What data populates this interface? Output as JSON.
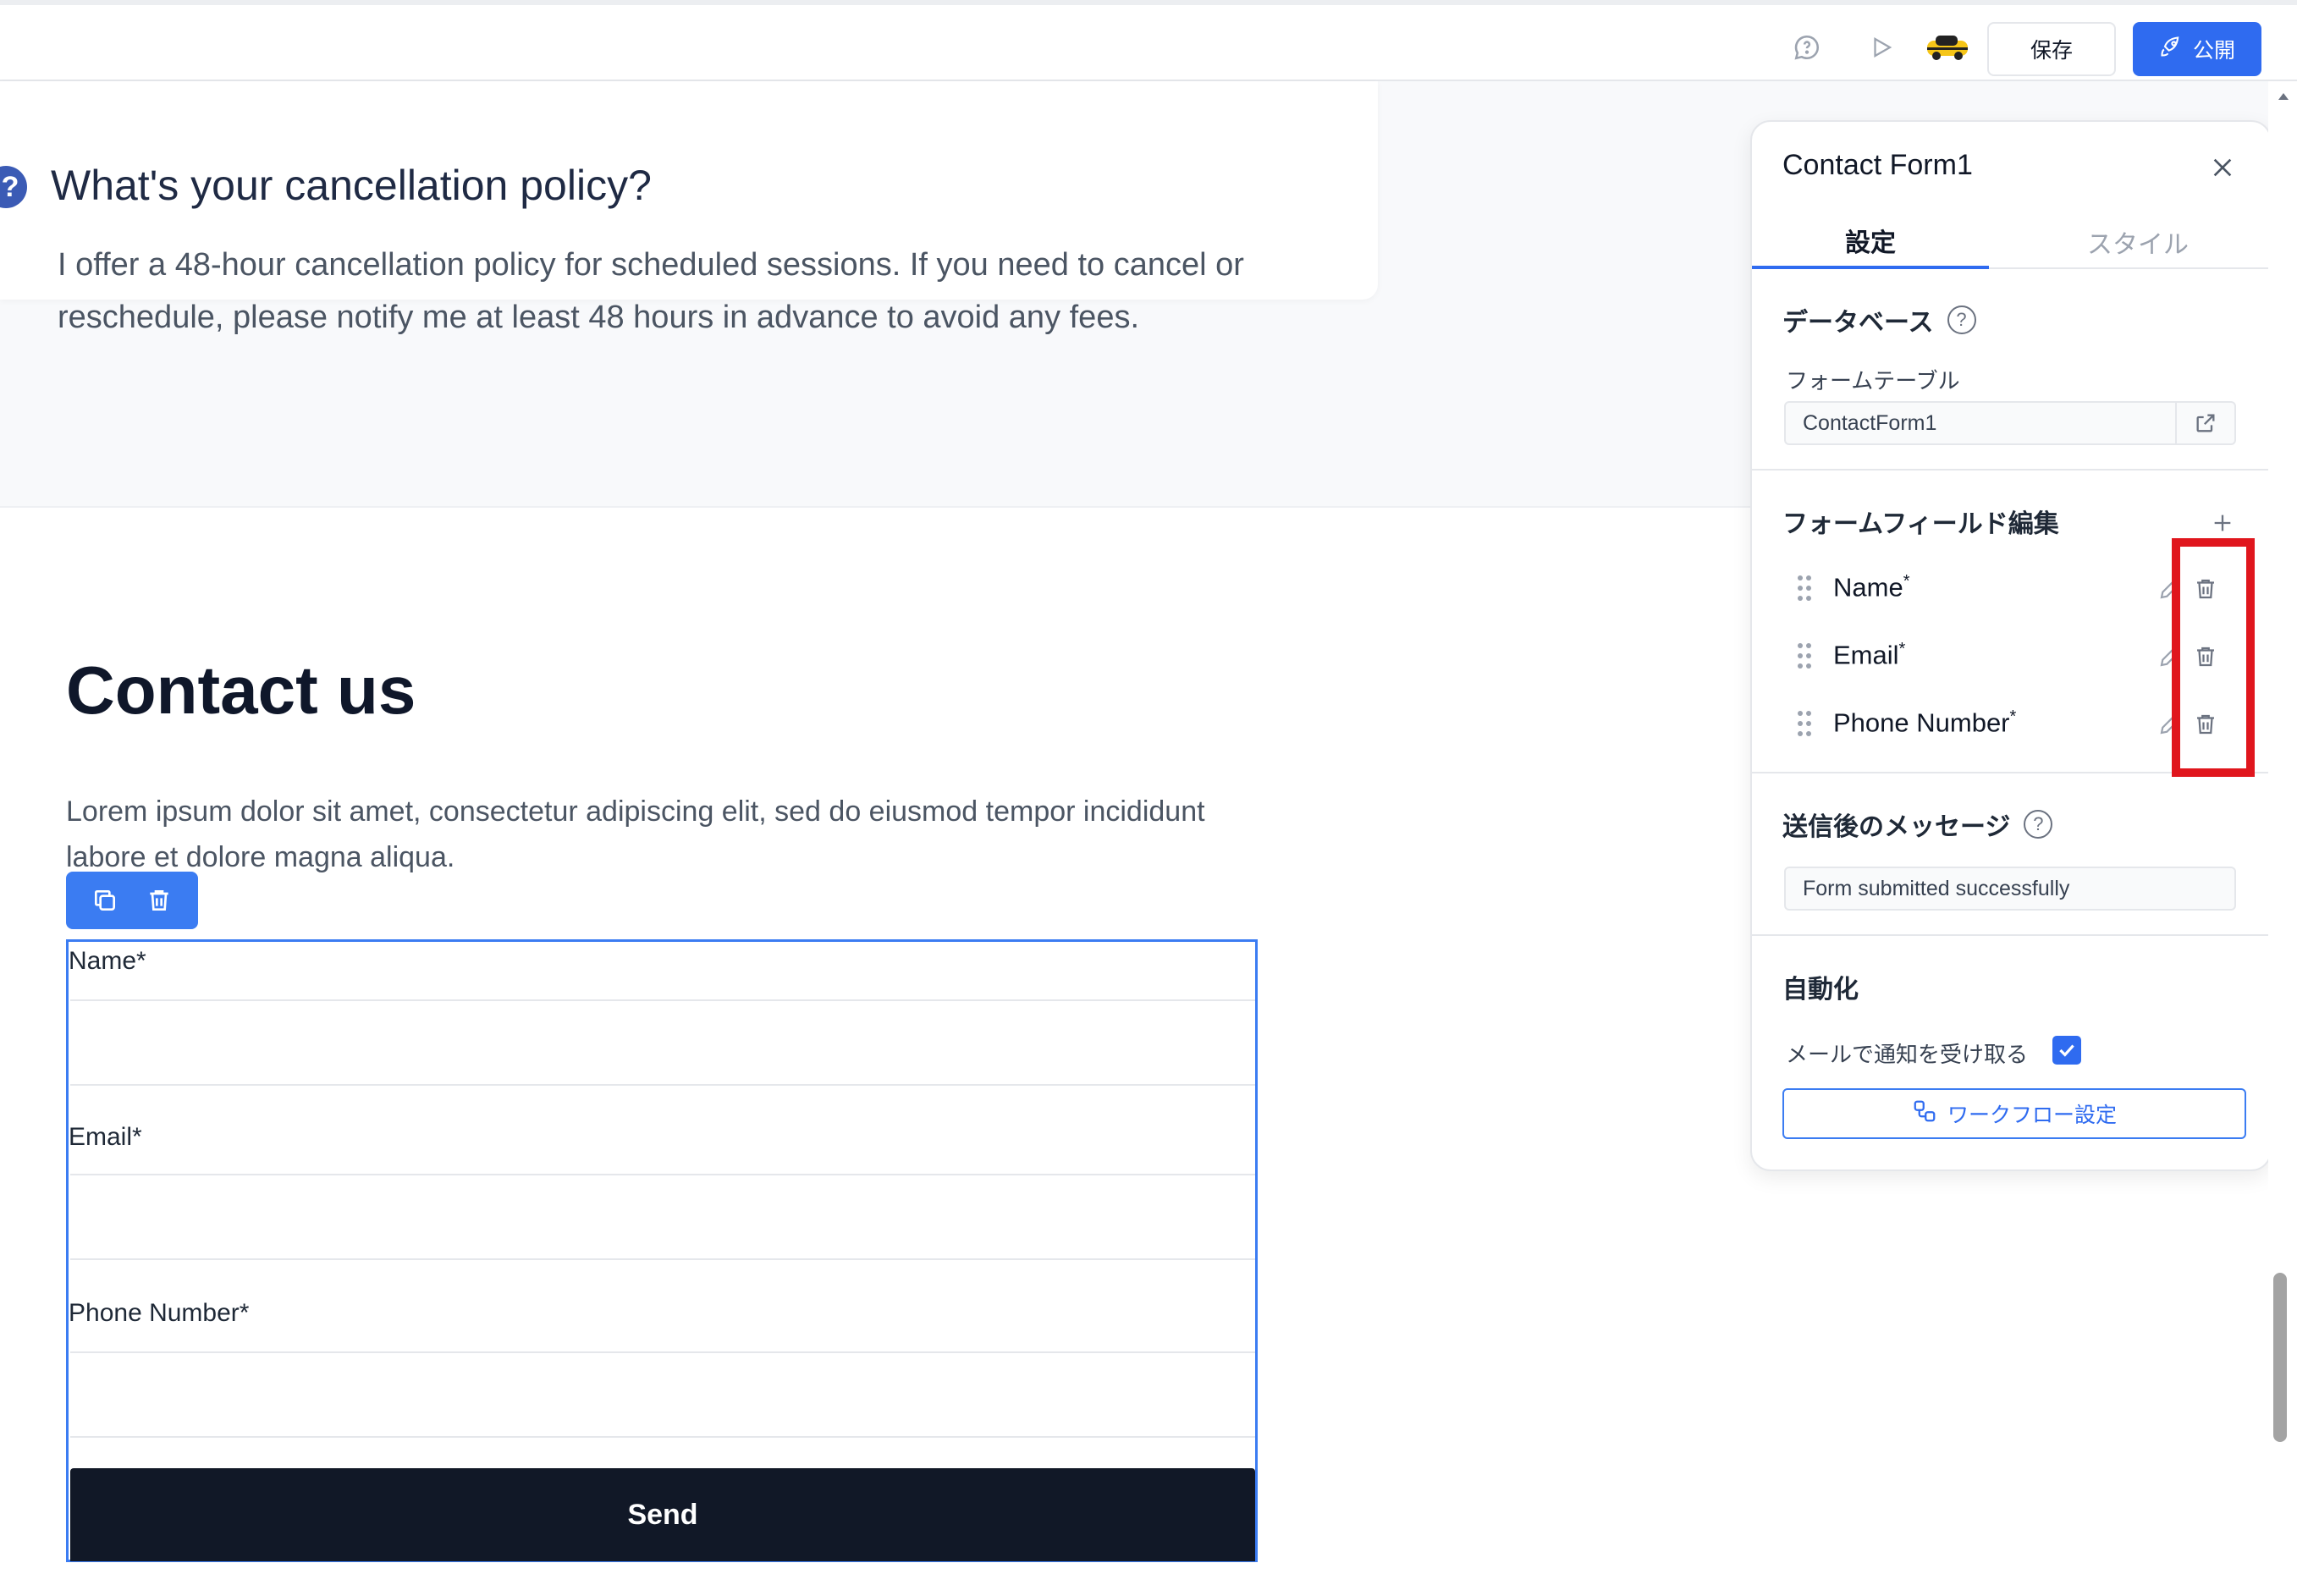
{
  "toolbar": {
    "save_label": "保存",
    "publish_label": "公開"
  },
  "faq": {
    "question": "What's your cancellation policy?",
    "answer": "I offer a 48-hour cancellation policy for scheduled sessions. If you need to cancel or reschedule, please notify me at least 48 hours in advance to avoid any fees."
  },
  "contact": {
    "title": "Contact us",
    "description": "Lorem ipsum dolor sit amet, consectetur adipiscing elit, sed do eiusmod tempor incididunt labore et dolore magna aliqua.",
    "fields": [
      {
        "label": "Name*"
      },
      {
        "label": "Email*"
      },
      {
        "label": "Phone Number*"
      }
    ],
    "send_label": "Send"
  },
  "panel": {
    "title": "Contact Form1",
    "tabs": [
      "設定",
      "スタイル"
    ],
    "database": {
      "heading": "データベース",
      "table_label": "フォームテーブル",
      "table_value": "ContactForm1"
    },
    "form_fields": {
      "heading": "フォームフィールド編集",
      "items": [
        {
          "name": "Name",
          "required_mark": "*"
        },
        {
          "name": "Email",
          "required_mark": "*"
        },
        {
          "name": "Phone Number",
          "required_mark": "*"
        }
      ]
    },
    "message": {
      "heading": "送信後のメッセージ",
      "value": "Form submitted successfully"
    },
    "automation": {
      "heading": "自動化",
      "email_notify_label": "メールで通知を受け取る",
      "email_notify_checked": true,
      "workflow_label": "ワークフロー設定"
    }
  },
  "colors": {
    "accent": "#2f6bf0",
    "highlight": "#e0161d",
    "send_button": "#111827"
  }
}
